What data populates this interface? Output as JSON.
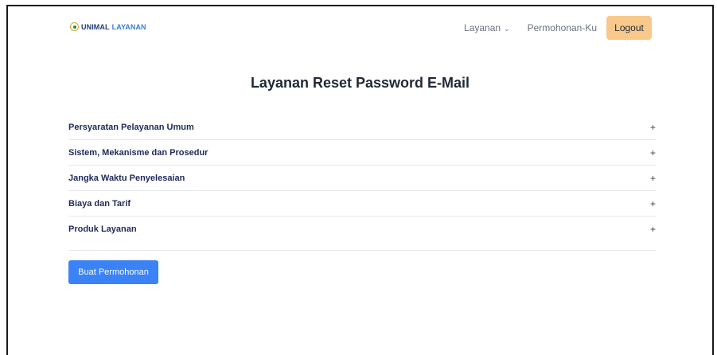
{
  "navbar": {
    "brand": {
      "part1": "UNIMAL",
      "part2": "LAYANAN",
      "logo_icon": "unimal-logo-icon"
    },
    "menu": [
      {
        "label": "Layanan",
        "icon": "chevron-down-icon",
        "glyph": "⌄"
      },
      {
        "label": "Permohonan-Ku"
      }
    ],
    "logout_label": "Logout"
  },
  "page": {
    "title": "Layanan Reset Password E-Mail"
  },
  "accordion": {
    "items": [
      {
        "label": "Persyaratan Pelayanan Umum",
        "toggle": "+"
      },
      {
        "label": "Sistem, Mekanisme dan Prosedur",
        "toggle": "+"
      },
      {
        "label": "Jangka Waktu Penyelesaian",
        "toggle": "+"
      },
      {
        "label": "Biaya dan Tarif",
        "toggle": "+"
      },
      {
        "label": "Produk Layanan",
        "toggle": "+"
      }
    ]
  },
  "actions": {
    "create_label": "Buat Permohonan"
  },
  "colors": {
    "logout_bg": "#f8c98b",
    "primary": "#3b82f6",
    "accordion_text": "#1e2a5a"
  }
}
